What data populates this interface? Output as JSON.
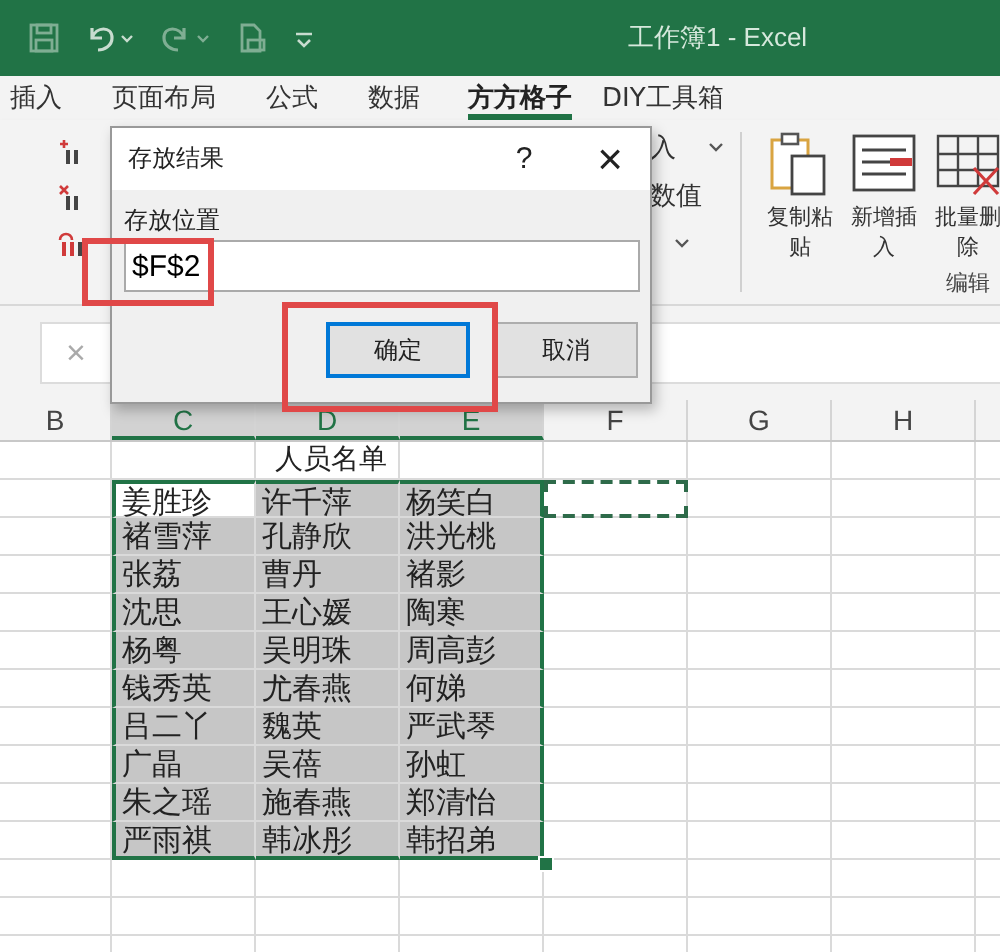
{
  "window": {
    "title": "工作簿1 - Excel"
  },
  "tabs": [
    {
      "label": "插入",
      "selected": false
    },
    {
      "label": "页面布局",
      "selected": false
    },
    {
      "label": "公式",
      "selected": false
    },
    {
      "label": "数据",
      "selected": false
    },
    {
      "label": "方方格子",
      "selected": true
    },
    {
      "label": "DIY工具箱",
      "selected": false
    }
  ],
  "ribbon": {
    "fragments": [
      {
        "label": "入",
        "dropdown": true
      },
      {
        "label": "数值",
        "dropdown": false
      }
    ],
    "buttons": [
      {
        "label": "复制粘贴",
        "kind": "paste"
      },
      {
        "label": "新增插入",
        "kind": "insert"
      },
      {
        "label": "批量删除",
        "kind": "delete"
      }
    ],
    "group_label": "编辑"
  },
  "formula_bar": {
    "cancel": "×"
  },
  "dialog": {
    "title": "存放结果",
    "help": "?",
    "close": "×",
    "field_label": "存放位置",
    "value": "$F$2",
    "buttons": [
      {
        "label": "确定",
        "default": true
      },
      {
        "label": "取消",
        "default": false
      }
    ]
  },
  "columns": [
    {
      "label": "B",
      "selected": false
    },
    {
      "label": "C",
      "selected": true
    },
    {
      "label": "D",
      "selected": true
    },
    {
      "label": "E",
      "selected": true
    },
    {
      "label": "F",
      "selected": false
    },
    {
      "label": "G",
      "selected": false
    },
    {
      "label": "H",
      "selected": false
    }
  ],
  "sheet": {
    "title": "人员名单",
    "copy_marquee": true,
    "rows": [
      {
        "cells": [
          {
            "text": "姜胜珍",
            "active": true
          },
          {
            "text": "许千萍",
            "active": false
          },
          {
            "text": "杨笑白",
            "active": false
          }
        ]
      },
      {
        "cells": [
          {
            "text": "褚雪萍",
            "active": false
          },
          {
            "text": "孔静欣",
            "active": false
          },
          {
            "text": "洪光桃",
            "active": false
          }
        ]
      },
      {
        "cells": [
          {
            "text": "张荔",
            "active": false
          },
          {
            "text": "曹丹",
            "active": false
          },
          {
            "text": "褚影",
            "active": false
          }
        ]
      },
      {
        "cells": [
          {
            "text": "沈思",
            "active": false
          },
          {
            "text": "王心媛",
            "active": false
          },
          {
            "text": "陶寒",
            "active": false
          }
        ]
      },
      {
        "cells": [
          {
            "text": "杨粤",
            "active": false
          },
          {
            "text": "吴明珠",
            "active": false
          },
          {
            "text": "周高彭",
            "active": false
          }
        ]
      },
      {
        "cells": [
          {
            "text": "钱秀英",
            "active": false
          },
          {
            "text": "尤春燕",
            "active": false
          },
          {
            "text": "何娣",
            "active": false
          }
        ]
      },
      {
        "cells": [
          {
            "text": "吕二丫",
            "active": false
          },
          {
            "text": "魏英",
            "active": false
          },
          {
            "text": "严武琴",
            "active": false
          }
        ]
      },
      {
        "cells": [
          {
            "text": "广晶",
            "active": false
          },
          {
            "text": "吴蓓",
            "active": false
          },
          {
            "text": "孙虹",
            "active": false
          }
        ]
      },
      {
        "cells": [
          {
            "text": "朱之瑶",
            "active": false
          },
          {
            "text": "施春燕",
            "active": false
          },
          {
            "text": "郑清怡",
            "active": false
          }
        ]
      },
      {
        "cells": [
          {
            "text": "严雨祺",
            "active": false
          },
          {
            "text": "韩冰彤",
            "active": false
          },
          {
            "text": "韩招弟",
            "active": false
          }
        ]
      }
    ]
  }
}
